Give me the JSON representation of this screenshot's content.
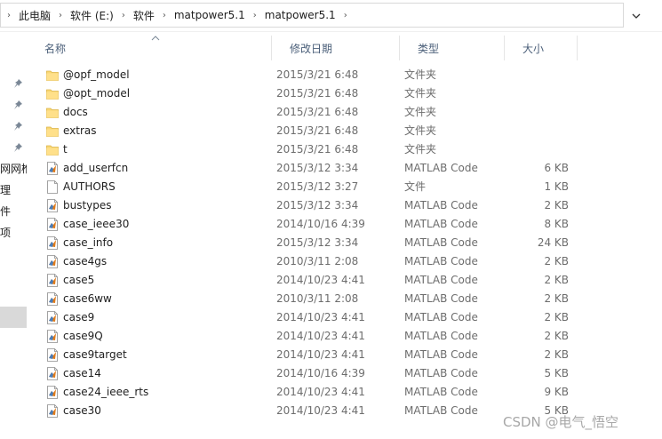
{
  "breadcrumb": [
    "此电脑",
    "软件 (E:)",
    "软件",
    "matpower5.1",
    "matpower5.1"
  ],
  "nav_pane": {
    "labels": [
      "网网椎",
      "理",
      "件",
      "项"
    ]
  },
  "columns": {
    "name": "名称",
    "date": "修改日期",
    "type": "类型",
    "size": "大小"
  },
  "files": [
    {
      "name": "@opf_model",
      "date": "2015/3/21 6:48",
      "type": "文件夹",
      "size": "",
      "icon": "folder-icon"
    },
    {
      "name": "@opt_model",
      "date": "2015/3/21 6:48",
      "type": "文件夹",
      "size": "",
      "icon": "folder-icon"
    },
    {
      "name": "docs",
      "date": "2015/3/21 6:48",
      "type": "文件夹",
      "size": "",
      "icon": "folder-icon"
    },
    {
      "name": "extras",
      "date": "2015/3/21 6:48",
      "type": "文件夹",
      "size": "",
      "icon": "folder-icon"
    },
    {
      "name": "t",
      "date": "2015/3/21 6:48",
      "type": "文件夹",
      "size": "",
      "icon": "folder-icon"
    },
    {
      "name": "add_userfcn",
      "date": "2015/3/12 3:34",
      "type": "MATLAB Code",
      "size": "6 KB",
      "icon": "matlab-file-icon"
    },
    {
      "name": "AUTHORS",
      "date": "2015/3/12 3:27",
      "type": "文件",
      "size": "1 KB",
      "icon": "blank-file-icon"
    },
    {
      "name": "bustypes",
      "date": "2015/3/12 3:34",
      "type": "MATLAB Code",
      "size": "2 KB",
      "icon": "matlab-file-icon"
    },
    {
      "name": "case_ieee30",
      "date": "2014/10/16 4:39",
      "type": "MATLAB Code",
      "size": "8 KB",
      "icon": "matlab-file-icon"
    },
    {
      "name": "case_info",
      "date": "2015/3/12 3:34",
      "type": "MATLAB Code",
      "size": "24 KB",
      "icon": "matlab-file-icon"
    },
    {
      "name": "case4gs",
      "date": "2010/3/11 2:08",
      "type": "MATLAB Code",
      "size": "2 KB",
      "icon": "matlab-file-icon"
    },
    {
      "name": "case5",
      "date": "2014/10/23 4:41",
      "type": "MATLAB Code",
      "size": "2 KB",
      "icon": "matlab-file-icon"
    },
    {
      "name": "case6ww",
      "date": "2010/3/11 2:08",
      "type": "MATLAB Code",
      "size": "2 KB",
      "icon": "matlab-file-icon"
    },
    {
      "name": "case9",
      "date": "2014/10/23 4:41",
      "type": "MATLAB Code",
      "size": "2 KB",
      "icon": "matlab-file-icon"
    },
    {
      "name": "case9Q",
      "date": "2014/10/23 4:41",
      "type": "MATLAB Code",
      "size": "2 KB",
      "icon": "matlab-file-icon"
    },
    {
      "name": "case9target",
      "date": "2014/10/23 4:41",
      "type": "MATLAB Code",
      "size": "2 KB",
      "icon": "matlab-file-icon"
    },
    {
      "name": "case14",
      "date": "2014/10/16 4:39",
      "type": "MATLAB Code",
      "size": "5 KB",
      "icon": "matlab-file-icon"
    },
    {
      "name": "case24_ieee_rts",
      "date": "2014/10/23 4:41",
      "type": "MATLAB Code",
      "size": "9 KB",
      "icon": "matlab-file-icon"
    },
    {
      "name": "case30",
      "date": "2014/10/23 4:41",
      "type": "MATLAB Code",
      "size": "5 KB",
      "icon": "matlab-file-icon"
    }
  ],
  "watermark": "CSDN @电气_悟空",
  "colors": {
    "folder": "#f8d775",
    "header_text": "#4c607a",
    "selected": "#d9d9d9"
  }
}
